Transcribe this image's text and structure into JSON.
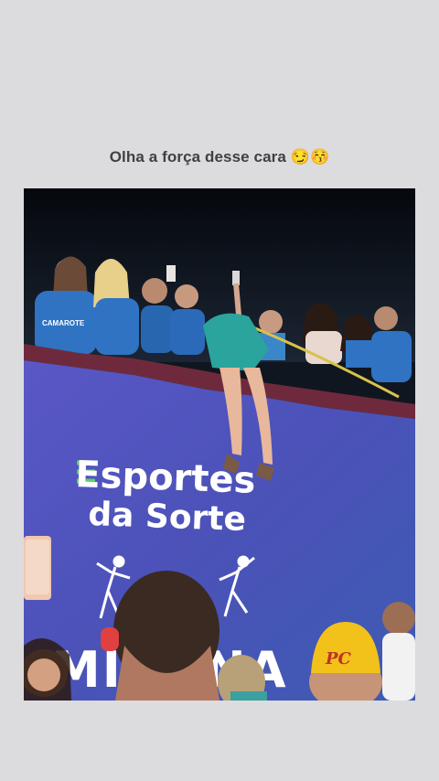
{
  "post": {
    "caption": "Olha a força desse cara 😏😚"
  },
  "photo": {
    "banner_line1": "Esportes",
    "banner_line2": "da Sorte",
    "banner_bottom": "MI    DINA",
    "cap_text": "PC",
    "shirt_text": "CAMAROTE",
    "colors": {
      "sky": "#0d1420",
      "banner": "#4a4fb8",
      "rail": "#6e2a3c",
      "shirts": "#2f73c2",
      "cap": "#f2c21b"
    }
  }
}
